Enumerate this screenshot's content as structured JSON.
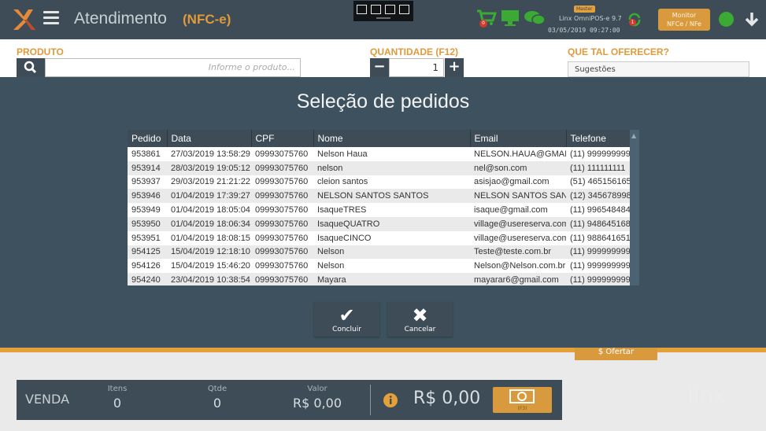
{
  "header": {
    "title": "Atendimento",
    "subtitle": "(NFC-e)",
    "master_badge": "Master",
    "app_name": "Linx OmniPOS-e 9.7",
    "datetime": "03/05/2019 09:27:00",
    "monitor_line1": "Monitor",
    "monitor_line2": "NFCe / NFe",
    "cart_badge": "0",
    "ecart_badge": "1",
    "icons": [
      "menu-icon",
      "select-icon",
      "pointer-icon",
      "fullscreen-icon",
      "capture-icon",
      "cart-icon",
      "desktop-icon",
      "chat-icon",
      "sync-icon",
      "online-icon",
      "download-icon"
    ]
  },
  "product": {
    "label": "PRODUTO",
    "placeholder": "Informe o produto..."
  },
  "quantity": {
    "label": "QUANTIDADE (F12)",
    "value": "1",
    "minus": "−",
    "plus": "+"
  },
  "offer": {
    "label": "QUE TAL OFERECER?",
    "suggestions": "Sugestões",
    "button": "$ Ofertar"
  },
  "modal": {
    "title": "Seleção de pedidos",
    "columns": [
      "Pedido",
      "Data",
      "CPF",
      "Nome",
      "Email",
      "Telefone"
    ],
    "rows": [
      [
        "953861",
        "27/03/2019 13:58:29",
        "09993075760",
        "Nelson Haua",
        "NELSON.HAUA@GMAIL",
        "(11) 999999999"
      ],
      [
        "953914",
        "28/03/2019 19:05:12",
        "09993075760",
        "nelson",
        "nel@son.com",
        "(11) 111111111"
      ],
      [
        "953937",
        "29/03/2019 21:21:22",
        "09993075760",
        "cleion santos",
        "asisjao@gmail.com",
        "(51) 465156165"
      ],
      [
        "953946",
        "01/04/2019 17:39:27",
        "09993075760",
        "NELSON SANTOS SANTOS",
        "NELSON SANTOS SANTOS",
        "(12) 345678998"
      ],
      [
        "953949",
        "01/04/2019 18:05:04",
        "09993075760",
        "IsaqueTRES",
        "isaque@gmail.com",
        "(11) 996548484"
      ],
      [
        "953950",
        "01/04/2019 18:06:34",
        "09993075760",
        "IsaqueQUATRO",
        "village@usereserva.com",
        "(11) 948645168"
      ],
      [
        "953951",
        "01/04/2019 18:08:15",
        "09993075760",
        "IsaqueCINCO",
        "village@usereserva.com",
        "(11) 988641651"
      ],
      [
        "954125",
        "15/04/2019 12:18:10",
        "09993075760",
        "Nelson",
        "Teste@teste.com.br",
        "(11) 999999999"
      ],
      [
        "954126",
        "15/04/2019 15:46:20",
        "09993075760",
        "Nelson",
        "Nelson@Nelson.com.br",
        "(11) 999999999"
      ],
      [
        "954240",
        "23/04/2019 10:38:54",
        "09993075760",
        "Mayara",
        "mayarar6@gmail.com",
        "(11) 999999999"
      ]
    ],
    "confirm_label": "Concluir",
    "cancel_label": "Cancelar",
    "watermark": "linx"
  },
  "footer": {
    "sale_label": "VENDA",
    "items_label": "Itens",
    "items_value": "0",
    "qty_label": "Qtde",
    "qty_value": "0",
    "value_label": "Valor",
    "value_value": "R$ 0,00",
    "total": "R$ 0,00",
    "pay_key": "(F3)"
  },
  "colors": {
    "header_bg": "#3d4c56",
    "accent": "#e5a03a",
    "overlay": "#374c59",
    "green": "#3aaa35"
  }
}
